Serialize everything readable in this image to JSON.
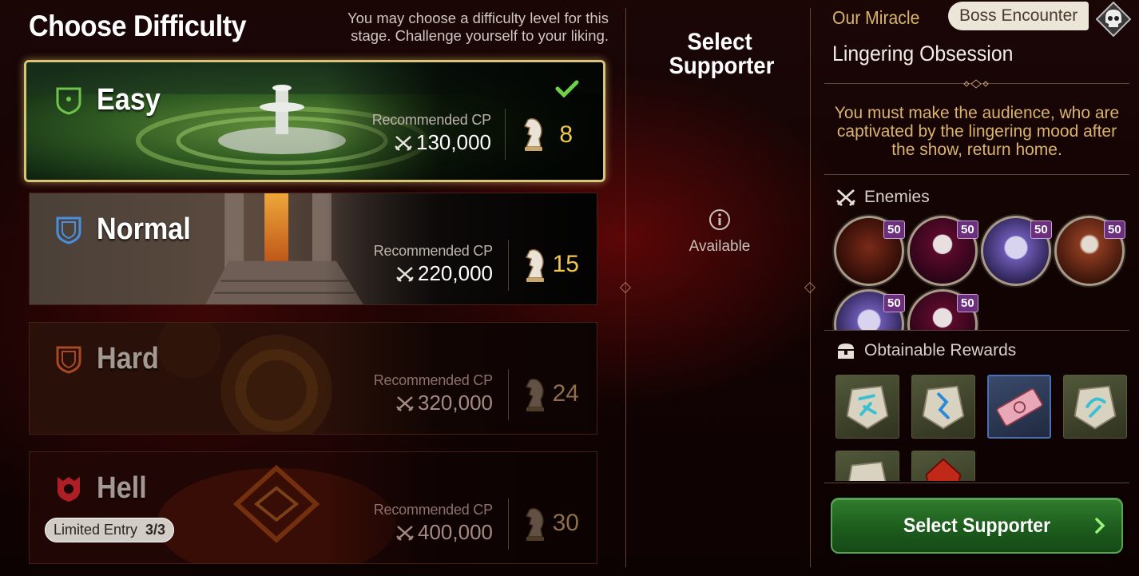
{
  "header": {
    "title": "Choose Difficulty",
    "subtitle": "You may choose a difficulty level for this stage. Challenge yourself to your liking."
  },
  "difficulties": [
    {
      "name": "Easy",
      "cp_label": "Recommended CP",
      "cp": "130,000",
      "tokens": "8",
      "selected": true,
      "locked": false,
      "color": "#6ec44b"
    },
    {
      "name": "Normal",
      "cp_label": "Recommended CP",
      "cp": "220,000",
      "tokens": "15",
      "selected": false,
      "locked": false,
      "color": "#4a8ee0"
    },
    {
      "name": "Hard",
      "cp_label": "Recommended CP",
      "cp": "320,000",
      "tokens": "24",
      "selected": false,
      "locked": true,
      "color": "#c8562c"
    },
    {
      "name": "Hell",
      "cp_label": "Recommended CP",
      "cp": "400,000",
      "tokens": "30",
      "selected": false,
      "locked": true,
      "color": "#c8242c"
    }
  ],
  "limited_entry": {
    "label": "Limited Entry",
    "count": "3/3"
  },
  "supporter": {
    "title": "Select Supporter",
    "status": "Available"
  },
  "miracle": {
    "label": "Our Miracle",
    "badge": "Boss Encounter",
    "name": "Lingering Obsession",
    "description": "You must make the audience, who are captivated by the lingering mood after the show, return home."
  },
  "enemies": {
    "title": "Enemies",
    "items": [
      {
        "name": "enemy-spiked-beast",
        "level": "50"
      },
      {
        "name": "enemy-masked-phantom",
        "level": "50"
      },
      {
        "name": "enemy-ghost-skull",
        "level": "50"
      },
      {
        "name": "enemy-bone-golem",
        "level": "50"
      },
      {
        "name": "enemy-ghost-skull",
        "level": "50"
      },
      {
        "name": "enemy-masked-phantom",
        "level": "50"
      }
    ]
  },
  "rewards": {
    "title": "Obtainable Rewards",
    "items": [
      {
        "name": "rune-stone-teal"
      },
      {
        "name": "rune-stone-blue"
      },
      {
        "name": "pink-ticket"
      },
      {
        "name": "rune-stone-teal"
      },
      {
        "name": "rune-stone-blue"
      },
      {
        "name": "red-crystal"
      }
    ]
  },
  "action": {
    "label": "Select Supporter"
  }
}
